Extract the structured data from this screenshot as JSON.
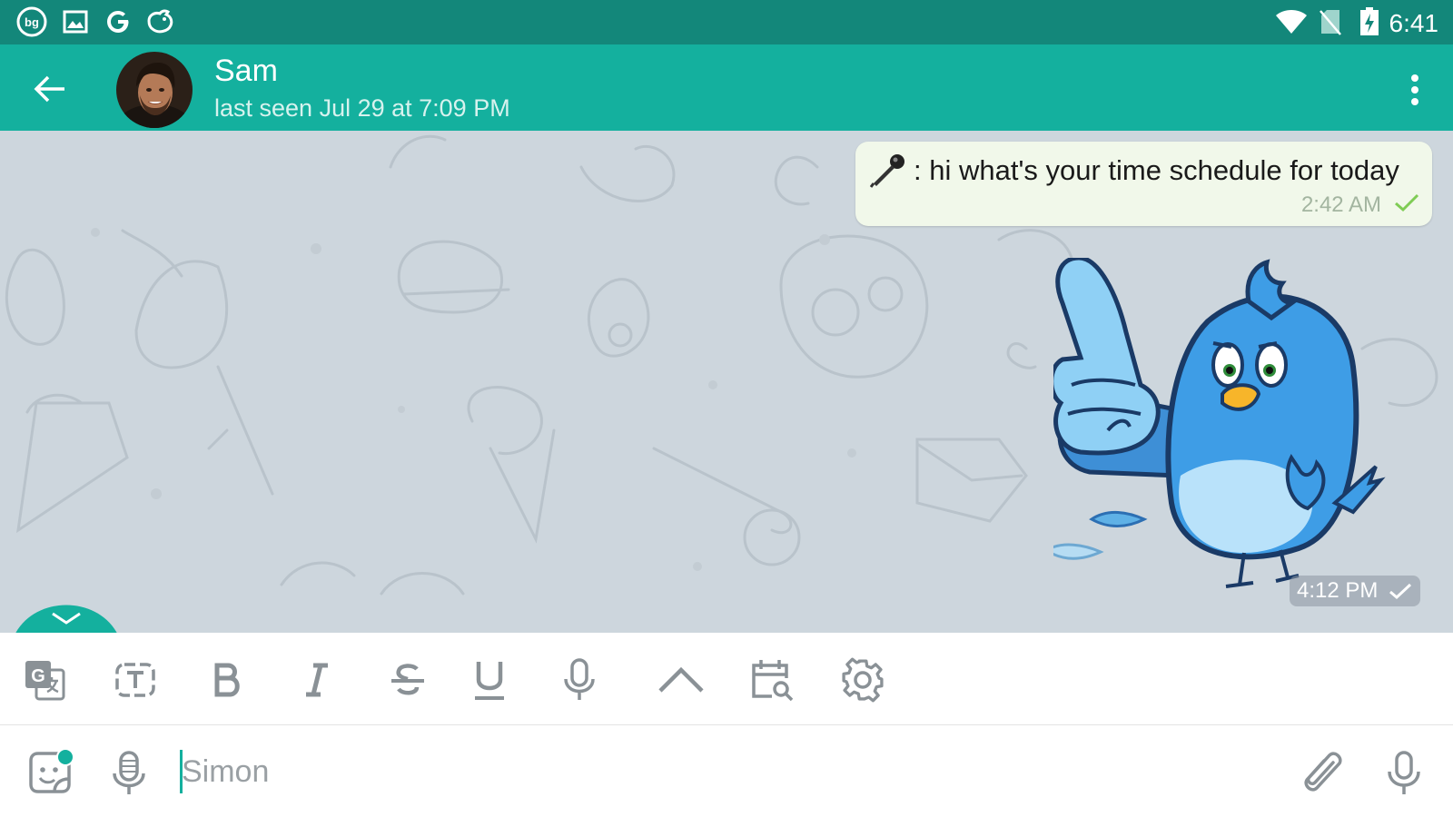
{
  "statusbar": {
    "time": "6:41",
    "left_icons": [
      "bg-app-icon",
      "gallery-icon",
      "google-icon",
      "bird-app-icon"
    ],
    "right_icons": [
      "wifi-icon",
      "no-sim-icon",
      "battery-charging-icon"
    ],
    "background": "#13877a"
  },
  "header": {
    "name": "Sam",
    "last_seen": "last seen Jul 29 at 7:09 PM",
    "accent": "#14b09e"
  },
  "messages": [
    {
      "type": "text",
      "text": ": hi what's your time schedule for today",
      "time": "2:42 AM",
      "status": "sent"
    },
    {
      "type": "sticker",
      "sticker": "blue-bird-thumbs-up",
      "time": "4:12 PM",
      "status": "sent"
    }
  ],
  "format_toolbar": [
    "translate-icon",
    "text-frame-icon",
    "bold-icon",
    "italic-icon",
    "strikethrough-icon",
    "underline-icon",
    "microphone-icon",
    "chevron-up-icon",
    "calendar-search-icon",
    "settings-icon"
  ],
  "composer": {
    "placeholder": "Simon",
    "value": ""
  }
}
